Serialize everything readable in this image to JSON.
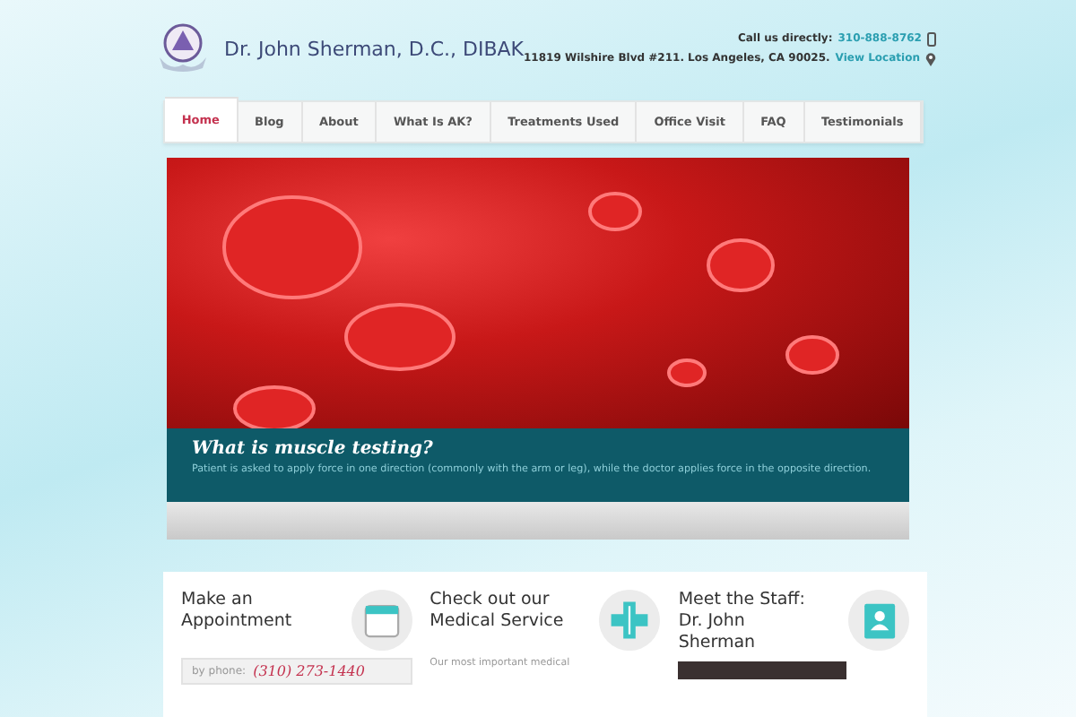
{
  "header": {
    "title": "Dr. John Sherman, D.C., DIBAK",
    "call_label": "Call us directly:",
    "phone": "310-888-8762",
    "address": "11819 Wilshire Blvd #211. Los Angeles, CA 90025.",
    "location_link": "View Location"
  },
  "nav": [
    {
      "label": "Home",
      "selected": true
    },
    {
      "label": "Blog",
      "selected": false
    },
    {
      "label": "About",
      "selected": false
    },
    {
      "label": "What Is AK?",
      "selected": false
    },
    {
      "label": "Treatments Used",
      "selected": false
    },
    {
      "label": "Office Visit",
      "selected": false
    },
    {
      "label": "FAQ",
      "selected": false
    },
    {
      "label": "Testimonials",
      "selected": false
    }
  ],
  "slider": {
    "caption_title": "What is muscle testing?",
    "caption_text": "Patient is asked to apply force in one direction (commonly with the arm or leg), while the doctor applies force in the opposite direction."
  },
  "features": [
    {
      "kind": "appointment",
      "title": "Make an Appointment",
      "phone_label": "by phone:",
      "phone": "(310) 273-1440"
    },
    {
      "kind": "service",
      "title": "Check out our Medical Service",
      "text": "Our most important medical"
    },
    {
      "kind": "staff",
      "title": "Meet the Staff: Dr. John Sherman"
    }
  ]
}
